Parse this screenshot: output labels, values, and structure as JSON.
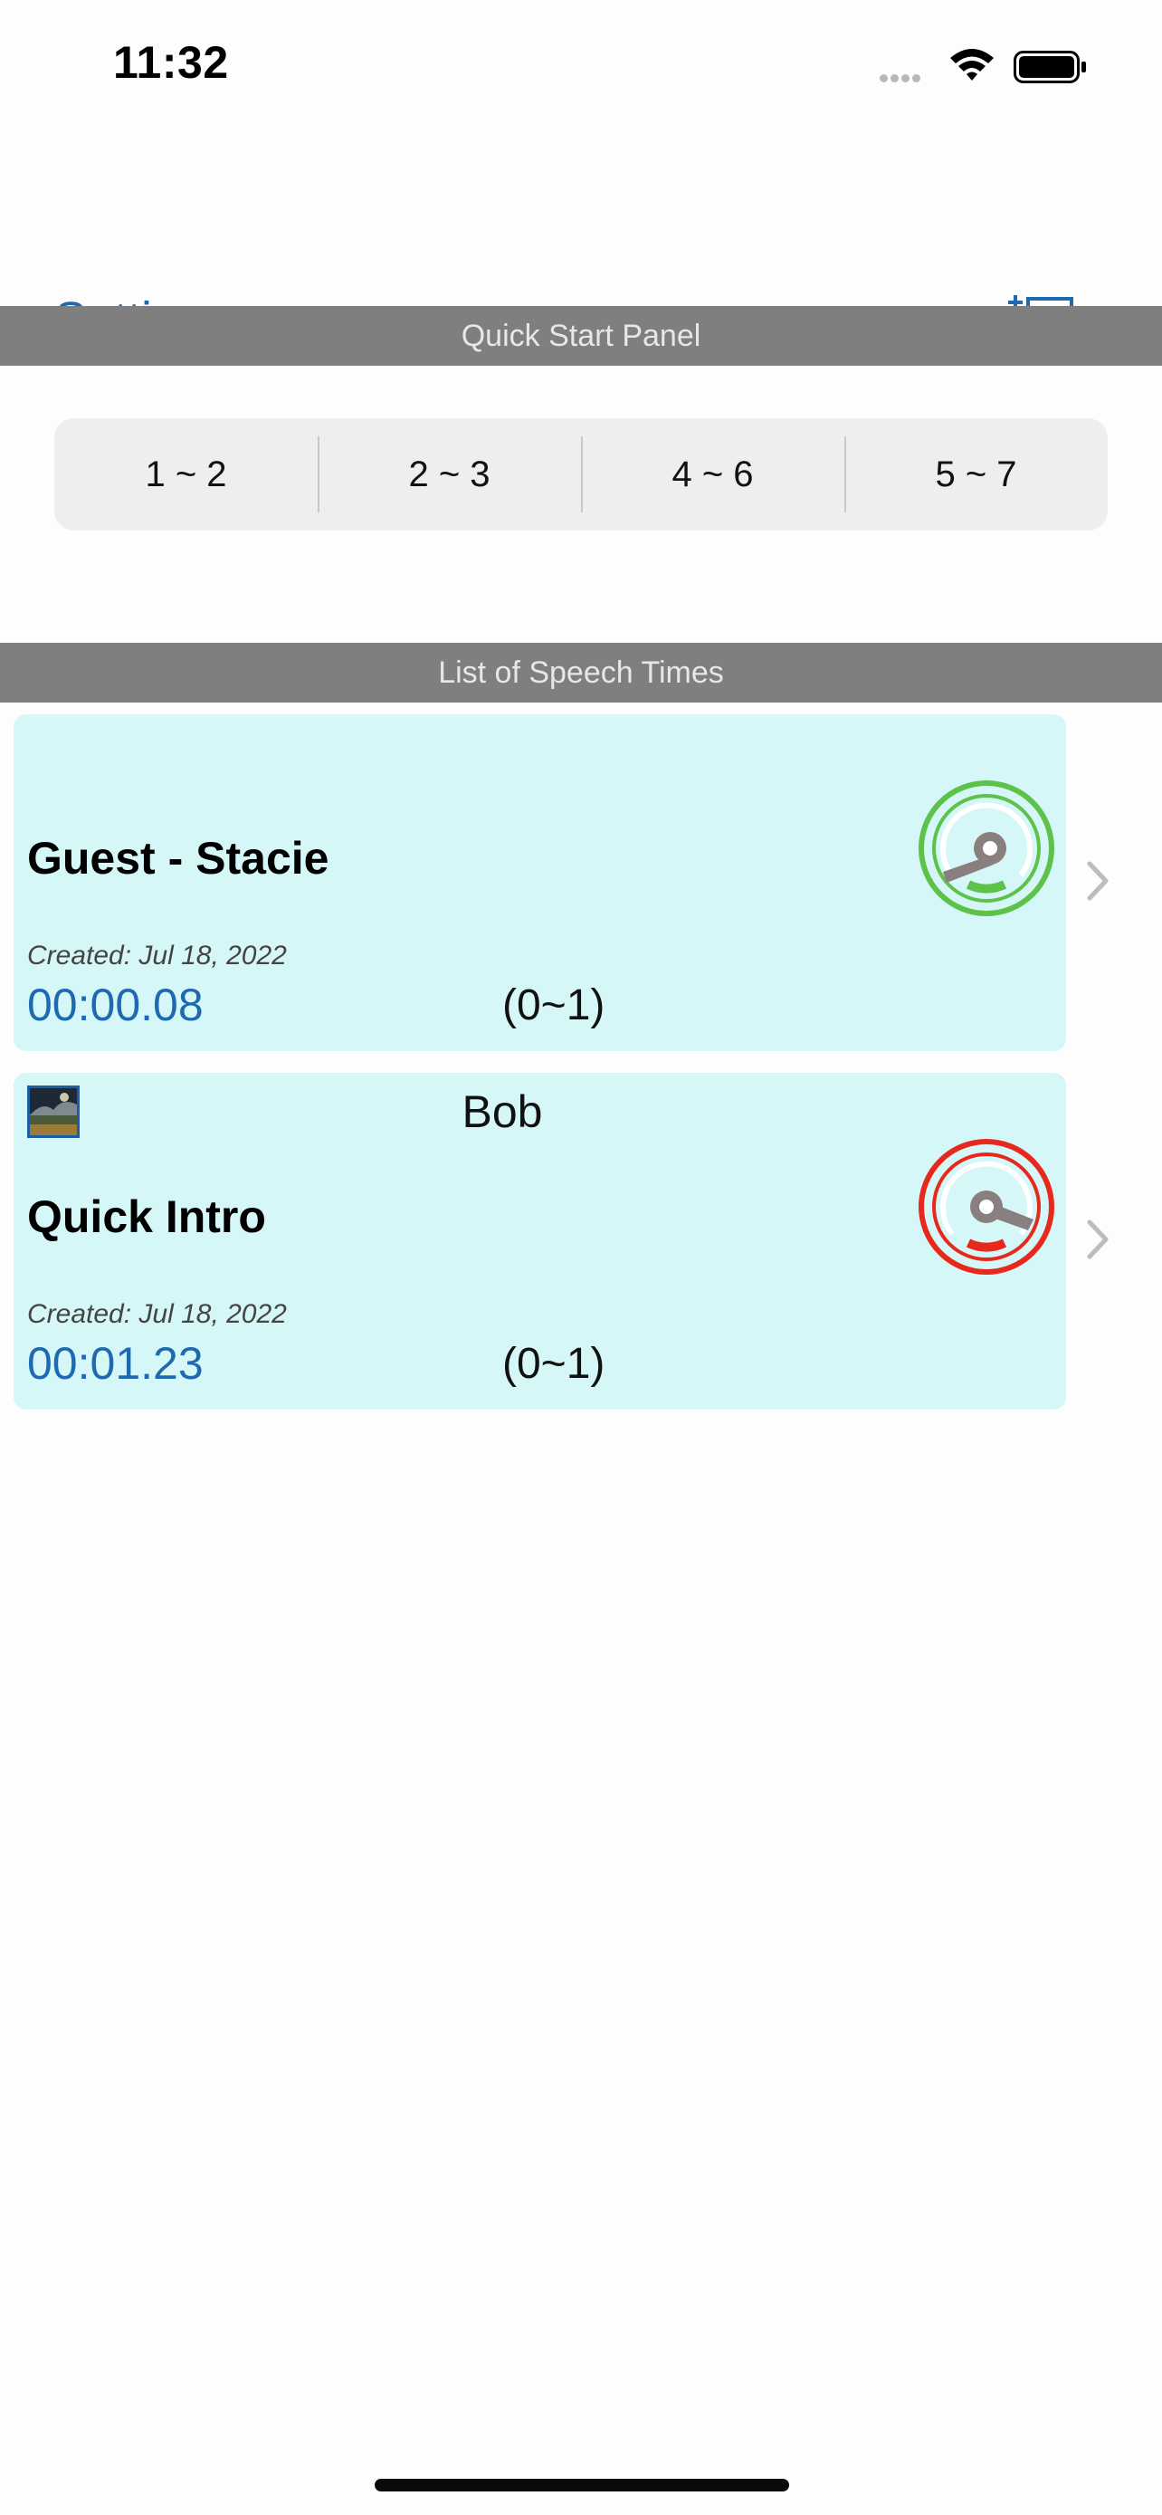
{
  "status_bar": {
    "time": "11:32"
  },
  "nav": {
    "settings_label": "Settings",
    "add_icon": "add-document-icon"
  },
  "quick_start": {
    "header": "Quick Start Panel",
    "segments": [
      "1 ~ 2",
      "2 ~ 3",
      "4 ~ 6",
      "5 ~ 7"
    ]
  },
  "list": {
    "header": "List of Speech Times",
    "items": [
      {
        "speaker": "",
        "title": "Guest - Stacie",
        "created": "Created:  Jul 18, 2022",
        "duration": "00:00.08",
        "range": "(0~1)",
        "gauge_color": "#5cc24a",
        "has_thumbnail": false
      },
      {
        "speaker": "Bob",
        "title": "Quick Intro",
        "created": "Created:  Jul 18, 2022",
        "duration": "00:01.23",
        "range": "(0~1)",
        "gauge_color": "#e8281c",
        "has_thumbnail": true
      }
    ]
  },
  "colors": {
    "accent": "#1f69b1",
    "card_bg": "#d5f7f7",
    "header_bg": "#7f7f7f"
  }
}
